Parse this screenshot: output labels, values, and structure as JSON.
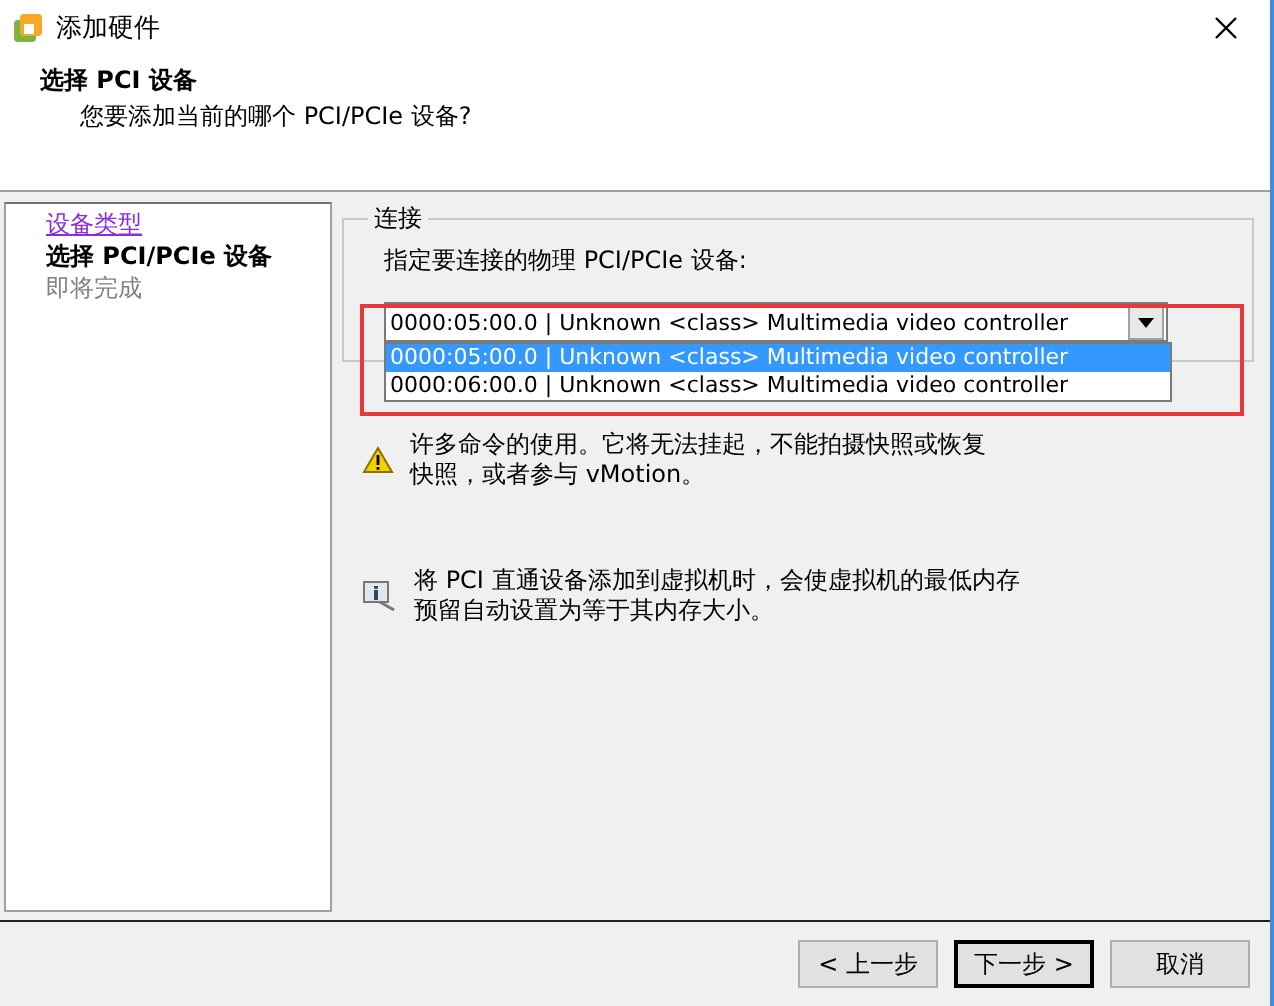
{
  "window": {
    "title": "添加硬件"
  },
  "header": {
    "title": "选择 PCI 设备",
    "subtitle": "您要添加当前的哪个 PCI/PCIe 设备?"
  },
  "steps": [
    {
      "label": "设备类型",
      "kind": "done"
    },
    {
      "label": "选择 PCI/PCIe 设备",
      "kind": "current"
    },
    {
      "label": "即将完成",
      "kind": "pending"
    }
  ],
  "connection": {
    "group_title": "连接",
    "prompt": "指定要连接的物理 PCI/PCIe 设备:",
    "value": "0000:05:00.0 | Unknown <class> Multimedia video controller",
    "expanded": true,
    "options": [
      {
        "label": "0000:05:00.0 | Unknown <class> Multimedia video controller",
        "selected": true
      },
      {
        "label": "0000:06:00.0 | Unknown <class> Multimedia video controller",
        "selected": false
      }
    ]
  },
  "notes": [
    {
      "kind": "warning",
      "lines": [
        "许多命令的使用。它将无法挂起，不能拍摄快照或恢复",
        "快照，或者参与 vMotion。"
      ]
    },
    {
      "kind": "info",
      "lines": [
        "将 PCI 直通设备添加到虚拟机时，会使虚拟机的最低内存",
        "预留自动设置为等于其内存大小。"
      ]
    }
  ],
  "buttons": [
    {
      "label": "< 上一步",
      "default": false
    },
    {
      "label": "下一步 >",
      "default": true
    },
    {
      "label": "取消",
      "default": false
    }
  ]
}
